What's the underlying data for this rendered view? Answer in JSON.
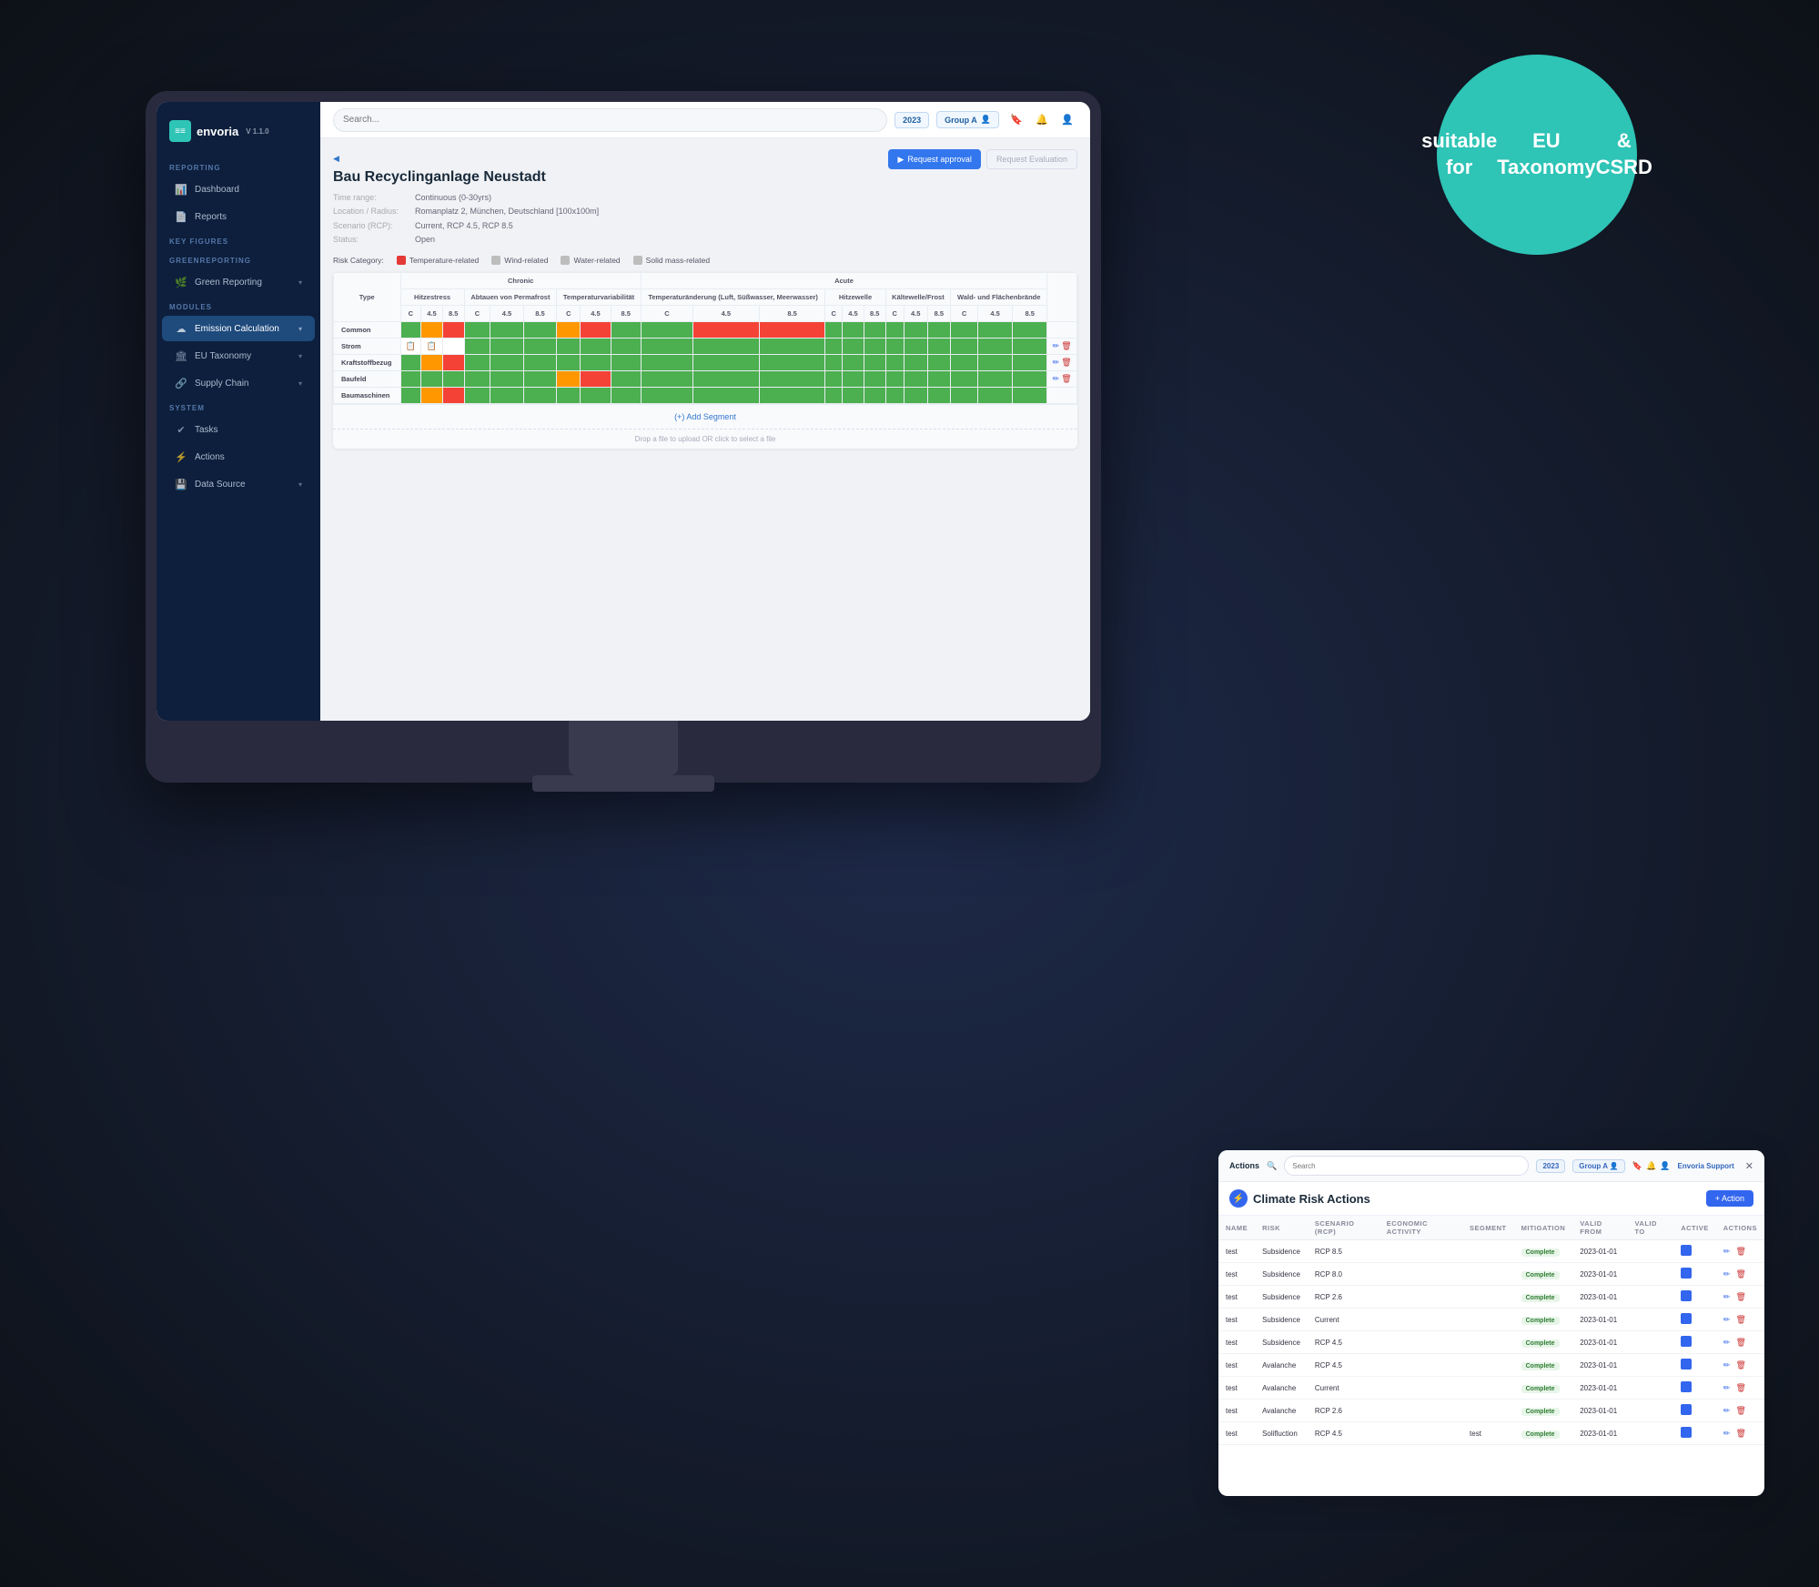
{
  "background": {
    "color": "#0d1117"
  },
  "teal_badge": {
    "line1": "suitable for",
    "line2": "EU Taxonomy",
    "line3": "& CSRD"
  },
  "sidebar": {
    "logo": "envoria",
    "version": "V 1.1.0",
    "sections": [
      {
        "label": "REPORTING",
        "items": [
          {
            "icon": "📊",
            "label": "Dashboard"
          },
          {
            "icon": "📄",
            "label": "Reports"
          }
        ]
      },
      {
        "label": "KEY FIGURES",
        "items": []
      },
      {
        "label": "GREENREPORTING",
        "items": [
          {
            "icon": "🌿",
            "label": "Green Reporting",
            "has_arrow": true
          }
        ]
      },
      {
        "label": "MODULES",
        "items": [
          {
            "icon": "☁",
            "label": "Emission Calculation",
            "active": true,
            "has_arrow": true
          },
          {
            "icon": "🏛",
            "label": "EU Taxonomy",
            "has_arrow": true
          },
          {
            "icon": "🔗",
            "label": "Supply Chain",
            "has_arrow": true
          }
        ]
      },
      {
        "label": "SYSTEM",
        "items": [
          {
            "icon": "✔",
            "label": "Tasks"
          },
          {
            "icon": "⚡",
            "label": "Actions"
          },
          {
            "icon": "💾",
            "label": "Data Source",
            "has_arrow": true
          }
        ]
      }
    ]
  },
  "topbar": {
    "search_placeholder": "Search...",
    "year": "2023",
    "group": "Group A",
    "icons": [
      "🔖",
      "🔔",
      "👤"
    ]
  },
  "main_content": {
    "back_label": "Back",
    "title": "Bau Recyclinganlage Neustadt",
    "meta": {
      "time_range_label": "Time range:",
      "time_range_value": "Continuous (0-30yrs)",
      "location_label": "Location / Radius:",
      "location_value": "Romanplatz 2, München, Deutschland [100x100m]",
      "scenario_label": "Scenario (RCP):",
      "scenario_value": "Current, RCP 4.5, RCP 8.5",
      "status_label": "Status:",
      "status_value": "Open"
    },
    "btn_request_approval": "Request approval",
    "btn_request_evaluation": "Request Evaluation",
    "risk_category_label": "Risk Category:",
    "legend": [
      {
        "label": "Temperature-related",
        "color": "#e53935"
      },
      {
        "label": "Wind-related",
        "color": "#bdbdbd"
      },
      {
        "label": "Water-related",
        "color": "#bdbdbd"
      },
      {
        "label": "Solid mass-related",
        "color": "#bdbdbd"
      }
    ],
    "table": {
      "type_header": "Type",
      "chronic_header": "Chronic",
      "acute_header": "Acute",
      "columns": [
        {
          "name": "Hitzestress",
          "scenarios": [
            "Current",
            "RCP 4.5",
            "RCP 8.5"
          ]
        },
        {
          "name": "Abtauen von Permafrost",
          "scenarios": [
            "Current",
            "RCP 4.5",
            "RCP 8.5"
          ]
        },
        {
          "name": "Temperaturvariabilität",
          "scenarios": [
            "Current",
            "RCP 4.5",
            "RCP 8.5"
          ]
        },
        {
          "name": "Temperaturänderung (Luft, Süßwasser, Meerwasser)",
          "scenarios": [
            "Current",
            "RCP 4.5",
            "RCP 8.5"
          ]
        },
        {
          "name": "Hitzewelle",
          "scenarios": [
            "Current",
            "RCP 4.5",
            "RCP 8.5"
          ]
        },
        {
          "name": "Kältewelle/Frost",
          "scenarios": [
            "Current",
            "RCP 4.5",
            "RCP 8.5"
          ]
        },
        {
          "name": "Wald- und Flächenbrände",
          "scenarios": [
            "Current",
            "RCP 4.5",
            "RCP 8.5"
          ]
        }
      ],
      "rows": [
        {
          "label": "Common",
          "cells": [
            "green",
            "orange",
            "red",
            "green",
            "green",
            "green",
            "orange",
            "red",
            "green",
            "green",
            "red",
            "red",
            "green",
            "green",
            "green",
            "green",
            "green",
            "green",
            "green",
            "green",
            "green"
          ]
        },
        {
          "label": "Strom",
          "cells": [
            "icon",
            "icon",
            "empty",
            "green",
            "green",
            "green",
            "green",
            "green",
            "green",
            "green",
            "green",
            "green",
            "green",
            "green",
            "green",
            "green",
            "green",
            "green",
            "green",
            "green",
            "green"
          ]
        },
        {
          "label": "Kraftstoffbezug",
          "cells": [
            "green",
            "orange",
            "red",
            "green",
            "green",
            "green",
            "green",
            "green",
            "green",
            "green",
            "green",
            "green",
            "green",
            "green",
            "green",
            "green",
            "green",
            "green",
            "green",
            "green",
            "green"
          ]
        },
        {
          "label": "Baufeld",
          "cells": [
            "green",
            "green",
            "green",
            "green",
            "green",
            "green",
            "orange",
            "red",
            "green",
            "green",
            "green",
            "green",
            "green",
            "green",
            "green",
            "green",
            "green",
            "green",
            "green",
            "green",
            "green"
          ]
        },
        {
          "label": "Baumaschinen",
          "cells": [
            "green",
            "orange",
            "red",
            "green",
            "green",
            "green",
            "green",
            "green",
            "green",
            "green",
            "green",
            "green",
            "green",
            "green",
            "green",
            "green",
            "green",
            "green",
            "green",
            "green",
            "green"
          ]
        }
      ],
      "add_segment": "(+) Add Segment",
      "drop_zone": "Drop a file to upload OR click to select a file"
    }
  },
  "actions_panel": {
    "title_label": "Actions",
    "search_placeholder": "Search",
    "year": "2023",
    "group": "Group A",
    "user_label": "Envoria Support",
    "section_title": "Climate Risk Actions",
    "add_btn": "+ Action",
    "table_headers": [
      "NAME",
      "RISK",
      "SCENARIO (RCP)",
      "ECONOMIC ACTIVITY",
      "SEGMENT",
      "MITIGATION",
      "VALID FROM",
      "VALID TO",
      "ACTIVE",
      "ACTIONS"
    ],
    "rows": [
      {
        "name": "test",
        "risk": "Subsidence",
        "scenario": "RCP 8.5",
        "economic_activity": "",
        "segment": "",
        "mitigation": "Complete",
        "valid_from": "2023-01-01",
        "valid_to": "",
        "active": true
      },
      {
        "name": "test",
        "risk": "Subsidence",
        "scenario": "RCP 8.0",
        "economic_activity": "",
        "segment": "",
        "mitigation": "Complete",
        "valid_from": "2023-01-01",
        "valid_to": "",
        "active": true
      },
      {
        "name": "test",
        "risk": "Subsidence",
        "scenario": "RCP 2.6",
        "economic_activity": "",
        "segment": "",
        "mitigation": "Complete",
        "valid_from": "2023-01-01",
        "valid_to": "",
        "active": true
      },
      {
        "name": "test",
        "risk": "Subsidence",
        "scenario": "Current",
        "economic_activity": "",
        "segment": "",
        "mitigation": "Complete",
        "valid_from": "2023-01-01",
        "valid_to": "",
        "active": true
      },
      {
        "name": "test",
        "risk": "Subsidence",
        "scenario": "RCP 4.5",
        "economic_activity": "",
        "segment": "",
        "mitigation": "Complete",
        "valid_from": "2023-01-01",
        "valid_to": "",
        "active": true
      },
      {
        "name": "test",
        "risk": "Avalanche",
        "scenario": "RCP 4.5",
        "economic_activity": "",
        "segment": "",
        "mitigation": "Complete",
        "valid_from": "2023-01-01",
        "valid_to": "",
        "active": true
      },
      {
        "name": "test",
        "risk": "Avalanche",
        "scenario": "Current",
        "economic_activity": "",
        "segment": "",
        "mitigation": "Complete",
        "valid_from": "2023-01-01",
        "valid_to": "",
        "active": true
      },
      {
        "name": "test",
        "risk": "Avalanche",
        "scenario": "RCP 2.6",
        "economic_activity": "",
        "segment": "",
        "mitigation": "Complete",
        "valid_from": "2023-01-01",
        "valid_to": "",
        "active": true
      },
      {
        "name": "test",
        "risk": "Solifluction",
        "scenario": "RCP 4.5",
        "economic_activity": "",
        "segment": "test",
        "mitigation": "Complete",
        "valid_from": "2023-01-01",
        "valid_to": "",
        "active": true
      }
    ]
  }
}
